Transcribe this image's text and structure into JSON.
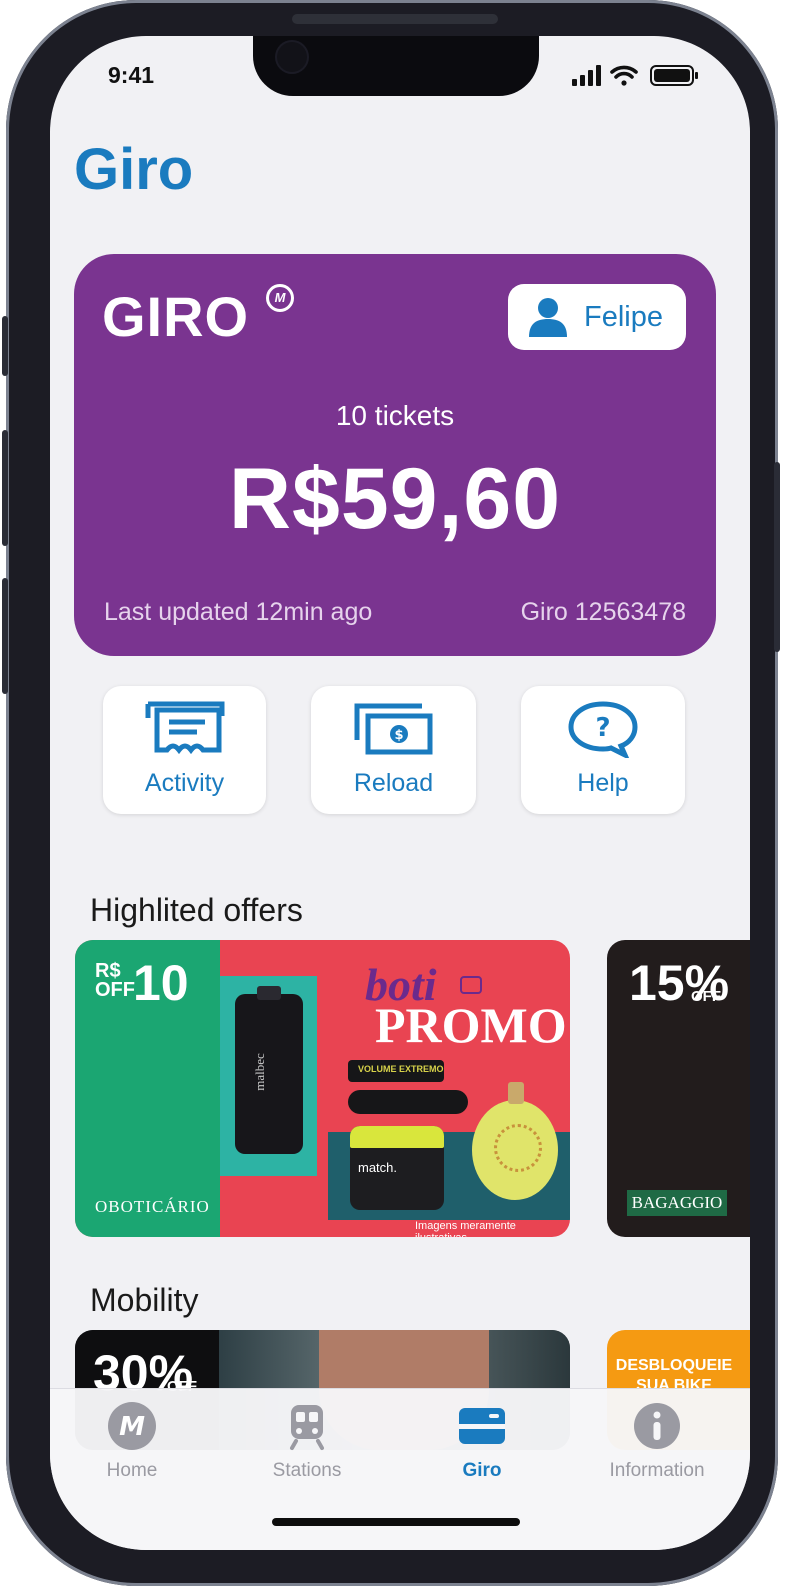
{
  "status_bar": {
    "time": "9:41"
  },
  "header": {
    "title": "Giro"
  },
  "card": {
    "brand": "GIRO",
    "brand_mark": "M",
    "user_name": "Felipe",
    "tickets": "10 tickets",
    "balance": "R$59,60",
    "last_updated": "Last updated 12min ago",
    "card_id": "Giro 12563478"
  },
  "actions": [
    {
      "label": "Activity",
      "icon": "receipt-icon"
    },
    {
      "label": "Reload",
      "icon": "cash-icon"
    },
    {
      "label": "Help",
      "icon": "help-bubble-icon"
    }
  ],
  "highlighted_offers": {
    "title": "Highlited offers",
    "offers": [
      {
        "brand": "OBOTICÁRIO",
        "discount_prefix": "R$ OFF",
        "discount": "10",
        "promo_a": "boti",
        "promo_b": "PROMO",
        "products": [
          "malbec",
          "match.",
          "VOLUME EXTREMO"
        ],
        "disclaimer": "Imagens meramente ilustrativas."
      },
      {
        "brand": "BAGAGGIO",
        "discount": "15%",
        "discount_suffix": "OFF"
      }
    ]
  },
  "mobility": {
    "title": "Mobility",
    "offers": [
      {
        "discount": "30%",
        "discount_suffix": "OFF"
      },
      {
        "text_line1": "DESBLOQUEIE",
        "text_line2": "SUA BIKE"
      }
    ]
  },
  "tabbar": {
    "items": [
      {
        "label": "Home",
        "icon": "metro-logo-icon",
        "active": false
      },
      {
        "label": "Stations",
        "icon": "train-icon",
        "active": false
      },
      {
        "label": "Giro",
        "icon": "card-icon",
        "active": true
      },
      {
        "label": "Information",
        "icon": "info-icon",
        "active": false
      }
    ]
  },
  "colors": {
    "accent": "#1a7bbf",
    "card": "#7a3490",
    "boticario_green": "#1ba672",
    "boticario_red": "#e94452",
    "bagaggio_bg": "#221c1c",
    "bike_orange": "#f59a12"
  }
}
